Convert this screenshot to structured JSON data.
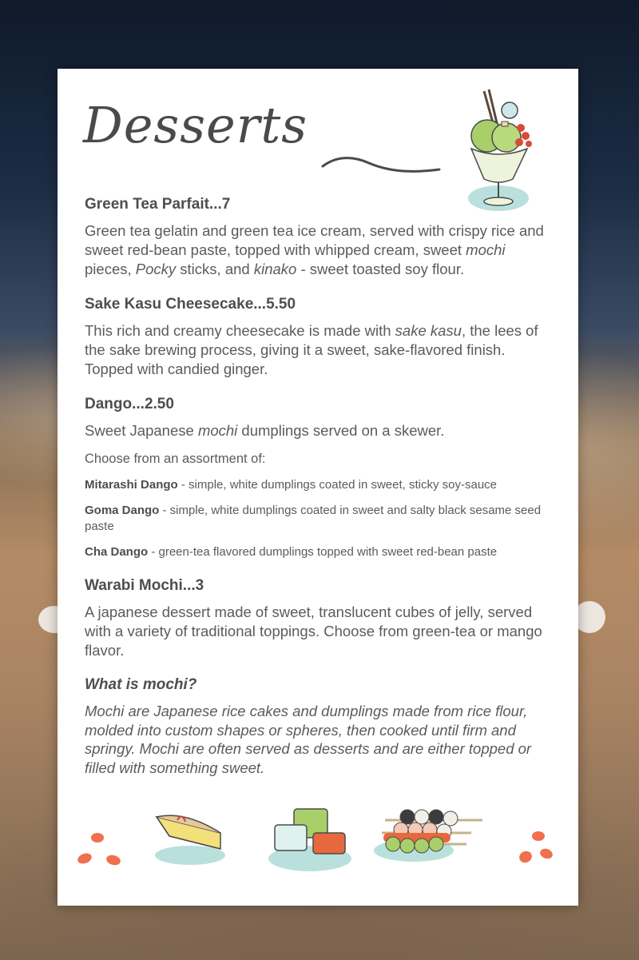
{
  "menu": {
    "title": "Desserts",
    "items": [
      {
        "name": "Green Tea Parfait...7",
        "description_parts": [
          "Green tea gelatin and green tea ice cream, served with crispy rice and sweet red-bean paste, topped with whipped cream, sweet ",
          "mochi",
          " pieces, ",
          "Pocky",
          " sticks, and ",
          "kinako",
          " - sweet toasted soy flour."
        ]
      },
      {
        "name": "Sake Kasu Cheesecake...5.50",
        "description_parts": [
          "This rich and creamy cheesecake is made with ",
          "sake kasu",
          ", the lees of the sake brewing process, giving it a sweet, sake-flavored finish. Topped with candied ginger."
        ]
      },
      {
        "name": "Dango...2.50",
        "description_parts": [
          "Sweet Japanese ",
          "mochi",
          " dumplings served on a skewer."
        ],
        "choose_label": "Choose from an assortment of:",
        "options": [
          {
            "name": "Mitarashi Dango",
            "desc": " - simple, white dumplings coated in sweet, sticky soy-sauce"
          },
          {
            "name": "Goma Dango",
            "desc": " - simple, white dumplings coated in sweet and salty black sesame seed paste"
          },
          {
            "name": "Cha Dango",
            "desc": " - green-tea flavored dumplings topped with sweet red-bean paste"
          }
        ]
      },
      {
        "name": "Warabi Mochi...3",
        "description_parts": [
          "A japanese dessert made of sweet, translucent cubes of jelly, served with a variety of traditional toppings. Choose from green-tea or mango flavor."
        ]
      }
    ],
    "faq": {
      "question": "What is mochi?",
      "answer": "Mochi are Japanese rice cakes and dumplings made from rice flour, molded into custom shapes or spheres, then cooked until firm and springy. Mochi are often served as desserts and are either topped or filled with something sweet."
    }
  },
  "illustrations": [
    "parfait-glass",
    "cheesecake-slice",
    "warabi-mochi-cubes",
    "dango-skewers",
    "orange-petals"
  ],
  "colors": {
    "text": "#555555",
    "heading": "#4e4e4e",
    "accent_teal": "#b9e0dd",
    "accent_orange": "#ef6f4f",
    "matcha_green": "#a8cf6a"
  }
}
